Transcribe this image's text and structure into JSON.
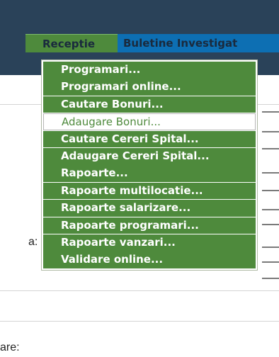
{
  "nav": {
    "tabs": [
      {
        "label": "Receptie"
      },
      {
        "label": "Buletine Investigat"
      }
    ]
  },
  "menu": {
    "items": [
      {
        "label": "Programari..."
      },
      {
        "label": "Programari online..."
      },
      {
        "label": "Cautare Bonuri..."
      },
      {
        "label": "Adaugare Bonuri...",
        "state": "hover"
      },
      {
        "label": "Cautare Cereri Spital..."
      },
      {
        "label": "Adaugare Cereri Spital..."
      },
      {
        "label": "Rapoarte..."
      },
      {
        "label": "Rapoarte multilocatie..."
      },
      {
        "label": "Rapoarte salarizare..."
      },
      {
        "label": "Rapoarte programari..."
      },
      {
        "label": "Rapoarte vanzari..."
      },
      {
        "label": "Validare online..."
      }
    ]
  },
  "page": {
    "label_a": "a:",
    "label_are": "are:"
  },
  "colors": {
    "header": "#2a4259",
    "menu_green": "#4e8a3c",
    "tab_blue": "#0d6fb3"
  }
}
